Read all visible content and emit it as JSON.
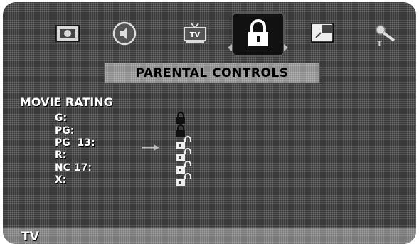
{
  "menu": {
    "icons": [
      {
        "name": "picture-icon"
      },
      {
        "name": "audio-icon"
      },
      {
        "name": "tv-icon",
        "label": "TV"
      },
      {
        "name": "lock-icon"
      },
      {
        "name": "pip-icon"
      },
      {
        "name": "setup-icon",
        "label": "T"
      }
    ],
    "selected": "lock-icon"
  },
  "title": "PARENTAL CONTROLS",
  "section_label": "MOVIE RATING",
  "ratings": [
    {
      "label": "G:",
      "state": "locked"
    },
    {
      "label": "PG:",
      "state": "locked"
    },
    {
      "label": "PG  13:",
      "state": "unlocked",
      "cursor": true
    },
    {
      "label": "R:",
      "state": "unlocked"
    },
    {
      "label": "NC 17:",
      "state": "unlocked"
    },
    {
      "label": "X:",
      "state": "unlocked"
    }
  ],
  "bottom_label": "TV",
  "colors": {
    "background": "#3a3a3a",
    "title_bar": "#8d8d8d",
    "bottom_bar": "#7a7a7a",
    "text": "#ffffff"
  }
}
